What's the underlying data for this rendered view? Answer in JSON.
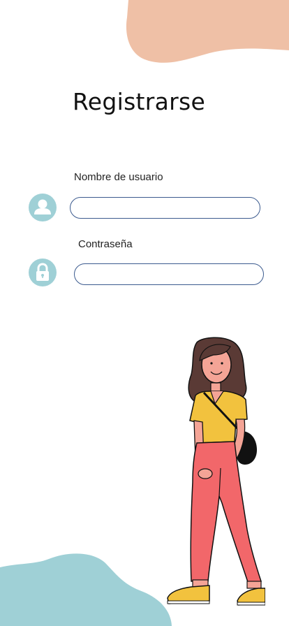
{
  "page": {
    "title": "Registrarse"
  },
  "form": {
    "username_label": "Nombre de usuario",
    "username_value": "",
    "password_label": "Contraseña",
    "password_value": ""
  },
  "icons": {
    "user": "user-icon",
    "lock": "lock-icon",
    "illustration": "walking-woman-illustration"
  },
  "colors": {
    "top_blob": "#efc0a6",
    "bottom_blob": "#9fd0d6",
    "icon_bg": "#9fd0d6",
    "input_border": "#3b5a8e"
  }
}
